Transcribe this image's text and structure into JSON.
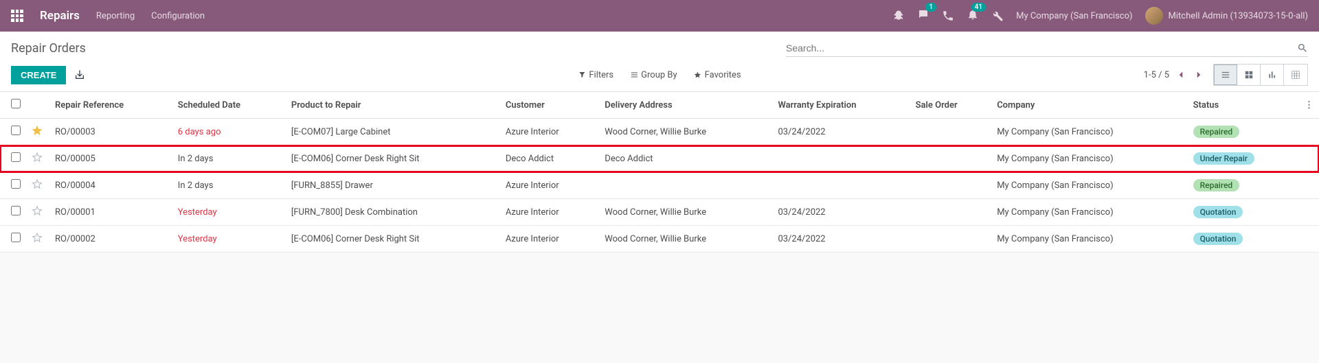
{
  "topnav": {
    "app_title": "Repairs",
    "links": [
      "Reporting",
      "Configuration"
    ],
    "notif_messages": "1",
    "notif_activities": "41",
    "company": "My Company (San Francisco)",
    "user": "Mitchell Admin (13934073-15-0-all)"
  },
  "controlbar": {
    "breadcrumb": "Repair Orders",
    "create_label": "CREATE",
    "search_placeholder": "Search...",
    "filters_label": "Filters",
    "groupby_label": "Group By",
    "favorites_label": "Favorites",
    "pager_text": "1-5 / 5"
  },
  "columns": {
    "ref": "Repair Reference",
    "sched": "Scheduled Date",
    "product": "Product to Repair",
    "customer": "Customer",
    "delivery": "Delivery Address",
    "warranty": "Warranty Expiration",
    "sale": "Sale Order",
    "company": "Company",
    "status": "Status"
  },
  "rows": [
    {
      "favorite": true,
      "ref": "RO/00003",
      "sched": "6 days ago",
      "sched_overdue": true,
      "product": "[E-COM07] Large Cabinet",
      "customer": "Azure Interior",
      "delivery": "Wood Corner, Willie Burke",
      "warranty": "03/24/2022",
      "sale": "",
      "company": "My Company (San Francisco)",
      "status": "Repaired",
      "status_class": "status-repaired",
      "highlight": false
    },
    {
      "favorite": false,
      "ref": "RO/00005",
      "sched": "In 2 days",
      "sched_overdue": false,
      "product": "[E-COM06] Corner Desk Right Sit",
      "customer": "Deco Addict",
      "delivery": "Deco Addict",
      "warranty": "",
      "sale": "",
      "company": "My Company (San Francisco)",
      "status": "Under Repair",
      "status_class": "status-underrepair",
      "highlight": true
    },
    {
      "favorite": false,
      "ref": "RO/00004",
      "sched": "In 2 days",
      "sched_overdue": false,
      "product": "[FURN_8855] Drawer",
      "customer": "Azure Interior",
      "delivery": "",
      "warranty": "",
      "sale": "",
      "company": "My Company (San Francisco)",
      "status": "Repaired",
      "status_class": "status-repaired",
      "highlight": false
    },
    {
      "favorite": false,
      "ref": "RO/00001",
      "sched": "Yesterday",
      "sched_overdue": true,
      "product": "[FURN_7800] Desk Combination",
      "customer": "Azure Interior",
      "delivery": "Wood Corner, Willie Burke",
      "warranty": "03/24/2022",
      "sale": "",
      "company": "My Company (San Francisco)",
      "status": "Quotation",
      "status_class": "status-quotation",
      "highlight": false
    },
    {
      "favorite": false,
      "ref": "RO/00002",
      "sched": "Yesterday",
      "sched_overdue": true,
      "product": "[E-COM06] Corner Desk Right Sit",
      "customer": "Azure Interior",
      "delivery": "Wood Corner, Willie Burke",
      "warranty": "03/24/2022",
      "sale": "",
      "company": "My Company (San Francisco)",
      "status": "Quotation",
      "status_class": "status-quotation",
      "highlight": false
    }
  ]
}
